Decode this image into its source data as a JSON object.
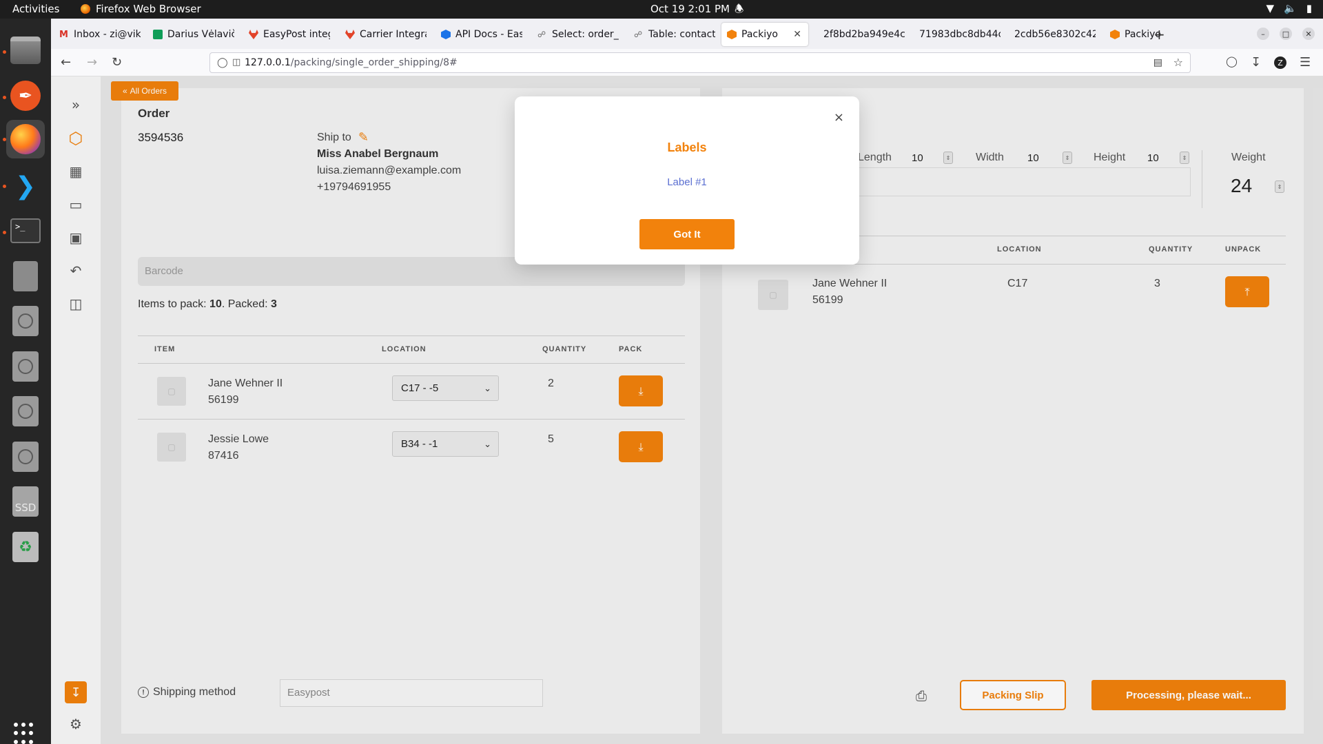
{
  "system": {
    "activities": "Activities",
    "app_name": "Firefox Web Browser",
    "clock": "Oct 19  2:01 PM"
  },
  "browser": {
    "tabs": [
      {
        "label": "Inbox - zi@viki",
        "fav_color": "#d93025"
      },
      {
        "label": "Darius Vėlavič",
        "fav_color": "#0f9d58"
      },
      {
        "label": "EasyPost integ",
        "fav_color": "#e24329"
      },
      {
        "label": "Carrier Integra",
        "fav_color": "#e24329"
      },
      {
        "label": "API Docs - Eas",
        "fav_color": "#1a73e8"
      },
      {
        "label": "Select: order_",
        "fav_color": "#888888"
      },
      {
        "label": "Table: contact",
        "fav_color": "#888888"
      },
      {
        "label": "Packiyo",
        "fav_color": "#f2820c"
      },
      {
        "label": "2f8bd2ba949e4c",
        "fav_color": ""
      },
      {
        "label": "71983dbc8db44c",
        "fav_color": ""
      },
      {
        "label": "2cdb56e8302c42",
        "fav_color": ""
      },
      {
        "label": "Packiyo",
        "fav_color": "#f2820c"
      }
    ],
    "active_tab_index": 7,
    "url_host": "127.0.0.1",
    "url_path": "/packing/single_order_shipping/8#"
  },
  "app": {
    "accent_color": "#f2820c",
    "all_orders": "All Orders",
    "order_label": "Order",
    "order_number": "3594536",
    "ship_to_label": "Ship to",
    "ship_name": "Miss Anabel Bergnaum",
    "ship_email": "luisa.ziemann@example.com",
    "ship_phone": "+19794691955",
    "barcode_placeholder": "Barcode",
    "items_to_pack_label": "Items to pack: ",
    "items_to_pack": "10",
    "packed_label": ". Packed: ",
    "packed": "3",
    "table_headers": {
      "item": "ITEM",
      "location": "LOCATION",
      "quantity": "QUANTITY",
      "pack": "PACK"
    },
    "items": [
      {
        "name": "Jane Wehner II",
        "sku": "56199",
        "location": "C17 - -5",
        "quantity": "2"
      },
      {
        "name": "Jessie Lowe",
        "sku": "87416",
        "location": "B34 - -1",
        "quantity": "5"
      }
    ],
    "shipping_method_label": "Shipping method",
    "shipping_method_placeholder": "Easypost",
    "box": {
      "length_label": "Length",
      "length": "10",
      "width_label": "Width",
      "width": "10",
      "height_label": "Height",
      "height": "10",
      "weight_label": "Weight",
      "weight": "24"
    },
    "packed_headers": {
      "location": "LOCATION",
      "quantity": "QUANTITY",
      "unpack": "UNPACK"
    },
    "packed_items": [
      {
        "name": "Jane Wehner II",
        "sku": "56199",
        "location": "C17",
        "quantity": "3"
      }
    ],
    "packing_slip": "Packing Slip",
    "processing": "Processing, please wait..."
  },
  "modal": {
    "title": "Labels",
    "label_link": "Label #1",
    "button": "Got It",
    "close": "×"
  }
}
